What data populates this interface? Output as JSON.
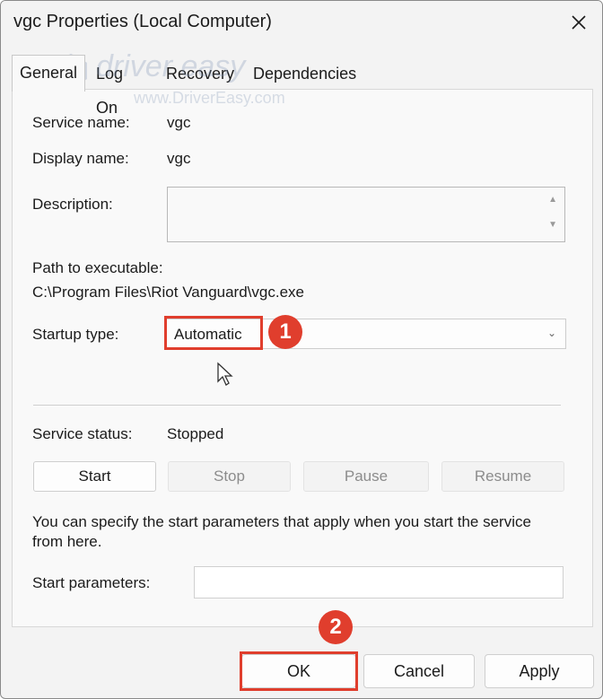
{
  "window": {
    "title": "vgc Properties (Local Computer)"
  },
  "tabs": [
    {
      "label": "General",
      "active": true
    },
    {
      "label": "Log On",
      "active": false
    },
    {
      "label": "Recovery",
      "active": false
    },
    {
      "label": "Dependencies",
      "active": false
    }
  ],
  "general": {
    "service_name_label": "Service name:",
    "service_name_value": "vgc",
    "display_name_label": "Display name:",
    "display_name_value": "vgc",
    "description_label": "Description:",
    "description_value": "",
    "path_label": "Path to executable:",
    "path_value": "C:\\Program Files\\Riot Vanguard\\vgc.exe",
    "startup_type_label": "Startup type:",
    "startup_type_value": "Automatic",
    "service_status_label": "Service status:",
    "service_status_value": "Stopped",
    "service_buttons": [
      {
        "label": "Start",
        "enabled": true
      },
      {
        "label": "Stop",
        "enabled": false
      },
      {
        "label": "Pause",
        "enabled": false
      },
      {
        "label": "Resume",
        "enabled": false
      }
    ],
    "help_text": "You can specify the start parameters that apply when you start the service from here.",
    "start_params_label": "Start parameters:",
    "start_params_value": ""
  },
  "footer": {
    "ok_label": "OK",
    "cancel_label": "Cancel",
    "apply_label": "Apply"
  },
  "annotations": {
    "step1": "1",
    "step2": "2",
    "color": "#e03e2d"
  },
  "watermark": {
    "brand": "driver easy",
    "url": "www.DriverEasy.com"
  }
}
